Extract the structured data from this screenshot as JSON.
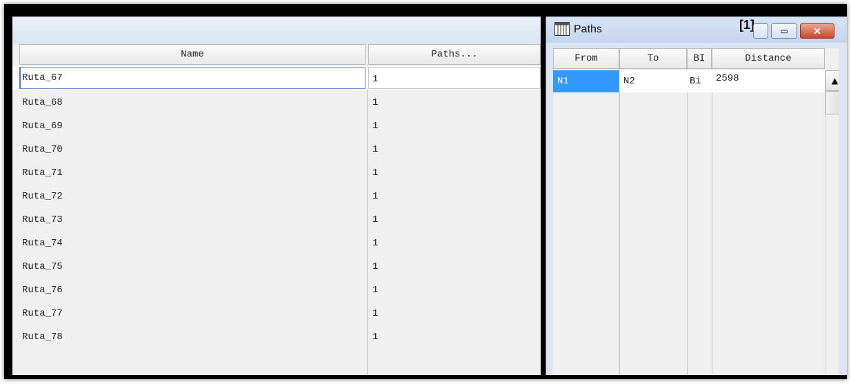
{
  "left_table": {
    "columns": [
      "Name",
      "Paths..."
    ],
    "rows": [
      {
        "name": "Ruta_67",
        "paths": "1"
      },
      {
        "name": "Ruta_68",
        "paths": "1"
      },
      {
        "name": "Ruta_69",
        "paths": "1"
      },
      {
        "name": "Ruta_70",
        "paths": "1"
      },
      {
        "name": "Ruta_71",
        "paths": "1"
      },
      {
        "name": "Ruta_72",
        "paths": "1"
      },
      {
        "name": "Ruta_73",
        "paths": "1"
      },
      {
        "name": "Ruta_74",
        "paths": "1"
      },
      {
        "name": "Ruta_75",
        "paths": "1"
      },
      {
        "name": "Ruta_76",
        "paths": "1"
      },
      {
        "name": "Ruta_77",
        "paths": "1"
      },
      {
        "name": "Ruta_78",
        "paths": "1"
      }
    ]
  },
  "paths_window": {
    "title": "Paths",
    "badge": "[1]",
    "icon": "grid-table-icon",
    "buttons": {
      "minimize": "",
      "restore": "▭",
      "close": "✕"
    },
    "columns": [
      "From",
      "To",
      "BI",
      "Distance"
    ],
    "rows": [
      {
        "from": "N1",
        "to": "N2",
        "bi": "Bi",
        "distance": "2598"
      }
    ],
    "scroll_up": "▲"
  },
  "colors": {
    "selection": "#3399ff",
    "title_bar": "#c4d5ec",
    "close_button": "#c7482b"
  }
}
